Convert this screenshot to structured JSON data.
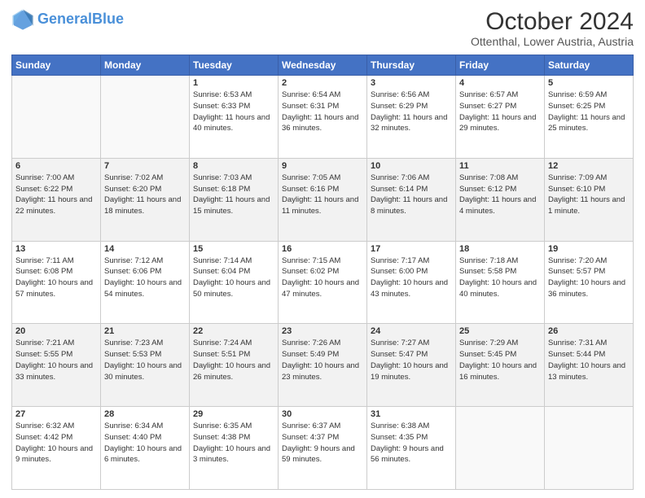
{
  "header": {
    "logo_line1": "General",
    "logo_line2": "Blue",
    "title": "October 2024",
    "subtitle": "Ottenthal, Lower Austria, Austria"
  },
  "days_of_week": [
    "Sunday",
    "Monday",
    "Tuesday",
    "Wednesday",
    "Thursday",
    "Friday",
    "Saturday"
  ],
  "weeks": [
    [
      {
        "day": "",
        "info": ""
      },
      {
        "day": "",
        "info": ""
      },
      {
        "day": "1",
        "info": "Sunrise: 6:53 AM\nSunset: 6:33 PM\nDaylight: 11 hours and 40 minutes."
      },
      {
        "day": "2",
        "info": "Sunrise: 6:54 AM\nSunset: 6:31 PM\nDaylight: 11 hours and 36 minutes."
      },
      {
        "day": "3",
        "info": "Sunrise: 6:56 AM\nSunset: 6:29 PM\nDaylight: 11 hours and 32 minutes."
      },
      {
        "day": "4",
        "info": "Sunrise: 6:57 AM\nSunset: 6:27 PM\nDaylight: 11 hours and 29 minutes."
      },
      {
        "day": "5",
        "info": "Sunrise: 6:59 AM\nSunset: 6:25 PM\nDaylight: 11 hours and 25 minutes."
      }
    ],
    [
      {
        "day": "6",
        "info": "Sunrise: 7:00 AM\nSunset: 6:22 PM\nDaylight: 11 hours and 22 minutes."
      },
      {
        "day": "7",
        "info": "Sunrise: 7:02 AM\nSunset: 6:20 PM\nDaylight: 11 hours and 18 minutes."
      },
      {
        "day": "8",
        "info": "Sunrise: 7:03 AM\nSunset: 6:18 PM\nDaylight: 11 hours and 15 minutes."
      },
      {
        "day": "9",
        "info": "Sunrise: 7:05 AM\nSunset: 6:16 PM\nDaylight: 11 hours and 11 minutes."
      },
      {
        "day": "10",
        "info": "Sunrise: 7:06 AM\nSunset: 6:14 PM\nDaylight: 11 hours and 8 minutes."
      },
      {
        "day": "11",
        "info": "Sunrise: 7:08 AM\nSunset: 6:12 PM\nDaylight: 11 hours and 4 minutes."
      },
      {
        "day": "12",
        "info": "Sunrise: 7:09 AM\nSunset: 6:10 PM\nDaylight: 11 hours and 1 minute."
      }
    ],
    [
      {
        "day": "13",
        "info": "Sunrise: 7:11 AM\nSunset: 6:08 PM\nDaylight: 10 hours and 57 minutes."
      },
      {
        "day": "14",
        "info": "Sunrise: 7:12 AM\nSunset: 6:06 PM\nDaylight: 10 hours and 54 minutes."
      },
      {
        "day": "15",
        "info": "Sunrise: 7:14 AM\nSunset: 6:04 PM\nDaylight: 10 hours and 50 minutes."
      },
      {
        "day": "16",
        "info": "Sunrise: 7:15 AM\nSunset: 6:02 PM\nDaylight: 10 hours and 47 minutes."
      },
      {
        "day": "17",
        "info": "Sunrise: 7:17 AM\nSunset: 6:00 PM\nDaylight: 10 hours and 43 minutes."
      },
      {
        "day": "18",
        "info": "Sunrise: 7:18 AM\nSunset: 5:58 PM\nDaylight: 10 hours and 40 minutes."
      },
      {
        "day": "19",
        "info": "Sunrise: 7:20 AM\nSunset: 5:57 PM\nDaylight: 10 hours and 36 minutes."
      }
    ],
    [
      {
        "day": "20",
        "info": "Sunrise: 7:21 AM\nSunset: 5:55 PM\nDaylight: 10 hours and 33 minutes."
      },
      {
        "day": "21",
        "info": "Sunrise: 7:23 AM\nSunset: 5:53 PM\nDaylight: 10 hours and 30 minutes."
      },
      {
        "day": "22",
        "info": "Sunrise: 7:24 AM\nSunset: 5:51 PM\nDaylight: 10 hours and 26 minutes."
      },
      {
        "day": "23",
        "info": "Sunrise: 7:26 AM\nSunset: 5:49 PM\nDaylight: 10 hours and 23 minutes."
      },
      {
        "day": "24",
        "info": "Sunrise: 7:27 AM\nSunset: 5:47 PM\nDaylight: 10 hours and 19 minutes."
      },
      {
        "day": "25",
        "info": "Sunrise: 7:29 AM\nSunset: 5:45 PM\nDaylight: 10 hours and 16 minutes."
      },
      {
        "day": "26",
        "info": "Sunrise: 7:31 AM\nSunset: 5:44 PM\nDaylight: 10 hours and 13 minutes."
      }
    ],
    [
      {
        "day": "27",
        "info": "Sunrise: 6:32 AM\nSunset: 4:42 PM\nDaylight: 10 hours and 9 minutes."
      },
      {
        "day": "28",
        "info": "Sunrise: 6:34 AM\nSunset: 4:40 PM\nDaylight: 10 hours and 6 minutes."
      },
      {
        "day": "29",
        "info": "Sunrise: 6:35 AM\nSunset: 4:38 PM\nDaylight: 10 hours and 3 minutes."
      },
      {
        "day": "30",
        "info": "Sunrise: 6:37 AM\nSunset: 4:37 PM\nDaylight: 9 hours and 59 minutes."
      },
      {
        "day": "31",
        "info": "Sunrise: 6:38 AM\nSunset: 4:35 PM\nDaylight: 9 hours and 56 minutes."
      },
      {
        "day": "",
        "info": ""
      },
      {
        "day": "",
        "info": ""
      }
    ]
  ]
}
